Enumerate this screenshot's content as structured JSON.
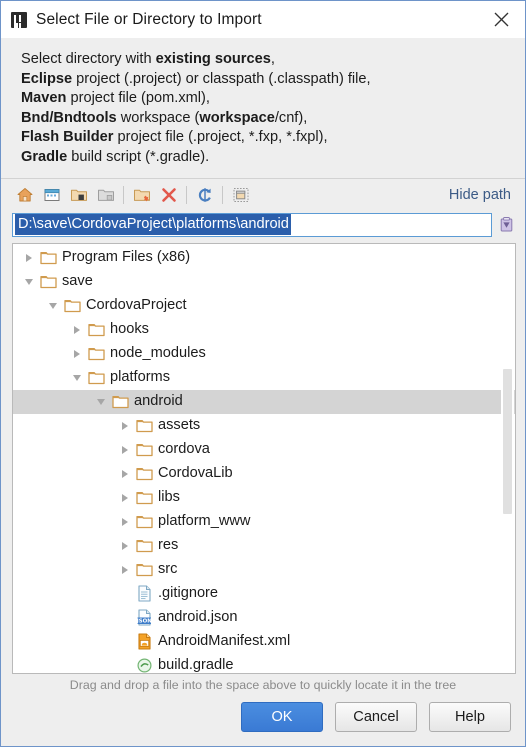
{
  "window": {
    "title": "Select File or Directory to Import",
    "app_icon": "intellij-icon",
    "close_icon": "close-icon"
  },
  "description": {
    "lines": [
      [
        {
          "t": "Select directory with ",
          "b": false
        },
        {
          "t": "existing sources",
          "b": true
        },
        {
          "t": ",",
          "b": false
        }
      ],
      [
        {
          "t": "Eclipse",
          "b": true
        },
        {
          "t": " project (.project) or classpath (.classpath) file,",
          "b": false
        }
      ],
      [
        {
          "t": "Maven",
          "b": true
        },
        {
          "t": " project file (pom.xml),",
          "b": false
        }
      ],
      [
        {
          "t": "Bnd/Bndtools",
          "b": true
        },
        {
          "t": " workspace (",
          "b": false
        },
        {
          "t": "workspace",
          "b": true
        },
        {
          "t": "/cnf),",
          "b": false
        }
      ],
      [
        {
          "t": "Flash Builder",
          "b": true
        },
        {
          "t": " project file (.project, *.fxp, *.fxpl),",
          "b": false
        }
      ],
      [
        {
          "t": "Gradle",
          "b": true
        },
        {
          "t": " build script (*.gradle).",
          "b": false
        }
      ]
    ]
  },
  "toolbar": {
    "buttons": [
      {
        "icon": "home-icon",
        "name": "home-button"
      },
      {
        "icon": "desktop-icon",
        "name": "desktop-button"
      },
      {
        "icon": "project-folder-icon",
        "name": "project-directory-button"
      },
      {
        "icon": "folder-up-icon",
        "name": "module-directory-button"
      },
      {
        "icon": "new-folder-icon",
        "name": "new-folder-button"
      },
      {
        "icon": "delete-x-icon",
        "name": "delete-button"
      },
      {
        "icon": "refresh-icon",
        "name": "refresh-button"
      },
      {
        "icon": "show-hidden-icon",
        "name": "show-hidden-files-button"
      }
    ],
    "hide_path_label": "Hide path"
  },
  "path": {
    "value": "D:\\save\\CordovaProject\\platforms\\android",
    "selected": true,
    "paste_icon": "paste-icon"
  },
  "tree": {
    "rows": [
      {
        "label": "Program Files (x86)",
        "depth": 1,
        "arrow": "collapsed",
        "icon": "folder-icon",
        "selected": false
      },
      {
        "label": "save",
        "depth": 1,
        "arrow": "expanded",
        "icon": "folder-icon",
        "selected": false
      },
      {
        "label": "CordovaProject",
        "depth": 2,
        "arrow": "expanded",
        "icon": "folder-icon",
        "selected": false
      },
      {
        "label": "hooks",
        "depth": 3,
        "arrow": "collapsed",
        "icon": "folder-icon",
        "selected": false
      },
      {
        "label": "node_modules",
        "depth": 3,
        "arrow": "collapsed",
        "icon": "folder-icon",
        "selected": false
      },
      {
        "label": "platforms",
        "depth": 3,
        "arrow": "expanded",
        "icon": "folder-icon",
        "selected": false
      },
      {
        "label": "android",
        "depth": 4,
        "arrow": "expanded",
        "icon": "folder-icon",
        "selected": true
      },
      {
        "label": "assets",
        "depth": 5,
        "arrow": "collapsed",
        "icon": "folder-icon",
        "selected": false
      },
      {
        "label": "cordova",
        "depth": 5,
        "arrow": "collapsed",
        "icon": "folder-icon",
        "selected": false
      },
      {
        "label": "CordovaLib",
        "depth": 5,
        "arrow": "collapsed",
        "icon": "folder-icon",
        "selected": false
      },
      {
        "label": "libs",
        "depth": 5,
        "arrow": "collapsed",
        "icon": "folder-icon",
        "selected": false
      },
      {
        "label": "platform_www",
        "depth": 5,
        "arrow": "collapsed",
        "icon": "folder-icon",
        "selected": false
      },
      {
        "label": "res",
        "depth": 5,
        "arrow": "collapsed",
        "icon": "folder-icon",
        "selected": false
      },
      {
        "label": "src",
        "depth": 5,
        "arrow": "collapsed",
        "icon": "folder-icon",
        "selected": false
      },
      {
        "label": ".gitignore",
        "depth": 5,
        "arrow": "none",
        "icon": "file-icon",
        "selected": false
      },
      {
        "label": "android.json",
        "depth": 5,
        "arrow": "none",
        "icon": "json-file-icon",
        "selected": false
      },
      {
        "label": "AndroidManifest.xml",
        "depth": 5,
        "arrow": "none",
        "icon": "android-xml-file-icon",
        "selected": false
      },
      {
        "label": "build.gradle",
        "depth": 5,
        "arrow": "none",
        "icon": "gradle-file-icon",
        "selected": false
      }
    ],
    "scrollbar": {
      "thumb_top_pct": 29,
      "thumb_height_pct": 34
    }
  },
  "hint": "Drag and drop a file into the space above to quickly locate it in the tree",
  "buttons": {
    "ok": "OK",
    "cancel": "Cancel",
    "help": "Help"
  }
}
